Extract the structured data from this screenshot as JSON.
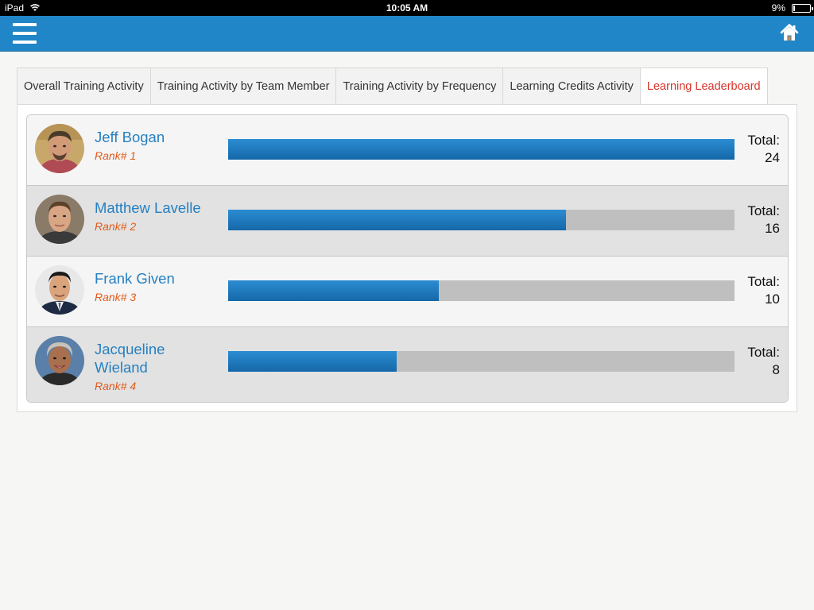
{
  "status_bar": {
    "device": "iPad",
    "time": "10:05 AM",
    "battery_percent": "9%",
    "battery_level": 0.09
  },
  "header": {
    "menu_icon": "hamburger-menu-icon",
    "home_icon": "home-icon",
    "color": "#2186c7"
  },
  "tabs": [
    {
      "label": "Overall Training Activity",
      "active": false
    },
    {
      "label": "Training Activity by Team Member",
      "active": false
    },
    {
      "label": "Training Activity by Frequency",
      "active": false
    },
    {
      "label": "Learning Credits Activity",
      "active": false
    },
    {
      "label": "Learning Leaderboard",
      "active": true
    }
  ],
  "leaderboard": {
    "max_total": 24,
    "rows": [
      {
        "name": "Jeff Bogan",
        "rank": "Rank# 1",
        "total_label": "Total:",
        "total": 24
      },
      {
        "name": "Matthew Lavelle",
        "rank": "Rank# 2",
        "total_label": "Total:",
        "total": 16
      },
      {
        "name": "Frank Given",
        "rank": "Rank# 3",
        "total_label": "Total:",
        "total": 10
      },
      {
        "name": "Jacqueline Wieland",
        "rank": "Rank# 4",
        "total_label": "Total:",
        "total": 8
      }
    ]
  },
  "colors": {
    "accent": "#2186c7",
    "name_text": "#2680c2",
    "rank_text": "#e05a1a",
    "active_tab": "#d9342a",
    "bar_fill": "#1a78bd",
    "bar_track": "#bfbfbf"
  }
}
